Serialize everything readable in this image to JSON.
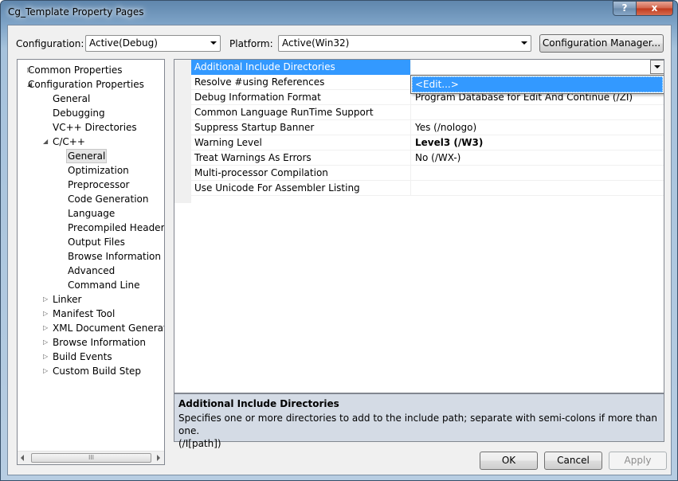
{
  "window": {
    "title": "Cg_Template Property Pages",
    "help_glyph": "?",
    "close_glyph": "x"
  },
  "toolbar": {
    "configuration_label": "Configuration:",
    "configuration_value": "Active(Debug)",
    "platform_label": "Platform:",
    "platform_value": "Active(Win32)",
    "config_manager_label": "Configuration Manager..."
  },
  "tree": {
    "items": [
      {
        "label": "Common Properties",
        "expander": "▷"
      },
      {
        "label": "Configuration Properties",
        "expander": "◢"
      },
      {
        "label": "General",
        "expander": ""
      },
      {
        "label": "Debugging",
        "expander": ""
      },
      {
        "label": "VC++ Directories",
        "expander": ""
      },
      {
        "label": "C/C++",
        "expander": "◢"
      },
      {
        "label": "General",
        "expander": "",
        "selected": true
      },
      {
        "label": "Optimization",
        "expander": ""
      },
      {
        "label": "Preprocessor",
        "expander": ""
      },
      {
        "label": "Code Generation",
        "expander": ""
      },
      {
        "label": "Language",
        "expander": ""
      },
      {
        "label": "Precompiled Headers",
        "expander": ""
      },
      {
        "label": "Output Files",
        "expander": ""
      },
      {
        "label": "Browse Information",
        "expander": ""
      },
      {
        "label": "Advanced",
        "expander": ""
      },
      {
        "label": "Command Line",
        "expander": ""
      },
      {
        "label": "Linker",
        "expander": "▷"
      },
      {
        "label": "Manifest Tool",
        "expander": "▷"
      },
      {
        "label": "XML Document Generator",
        "expander": "▷"
      },
      {
        "label": "Browse Information",
        "expander": "▷"
      },
      {
        "label": "Build Events",
        "expander": "▷"
      },
      {
        "label": "Custom Build Step",
        "expander": "▷"
      }
    ],
    "scroll_grip": "III"
  },
  "properties": {
    "rows": [
      {
        "name": "Additional Include Directories",
        "value": "",
        "selected": true,
        "bold": false
      },
      {
        "name": "Resolve #using References",
        "value": "",
        "selected": false,
        "bold": false
      },
      {
        "name": "Debug Information Format",
        "value": "Program Database for Edit And Continue (/ZI)",
        "selected": false,
        "bold": false
      },
      {
        "name": "Common Language RunTime Support",
        "value": "",
        "selected": false,
        "bold": false
      },
      {
        "name": "Suppress Startup Banner",
        "value": "Yes (/nologo)",
        "selected": false,
        "bold": false
      },
      {
        "name": "Warning Level",
        "value": "Level3 (/W3)",
        "selected": false,
        "bold": true
      },
      {
        "name": "Treat Warnings As Errors",
        "value": "No (/WX-)",
        "selected": false,
        "bold": false
      },
      {
        "name": "Multi-processor Compilation",
        "value": "",
        "selected": false,
        "bold": false
      },
      {
        "name": "Use Unicode For Assembler Listing",
        "value": "",
        "selected": false,
        "bold": false
      }
    ],
    "dropdown_option": "<Edit...>"
  },
  "description": {
    "title": "Additional Include Directories",
    "text": "Specifies one or more directories to add to the include path; separate with semi-colons if more than one.",
    "switch": "(/I[path])"
  },
  "buttons": {
    "ok": "OK",
    "cancel": "Cancel",
    "apply": "Apply"
  }
}
